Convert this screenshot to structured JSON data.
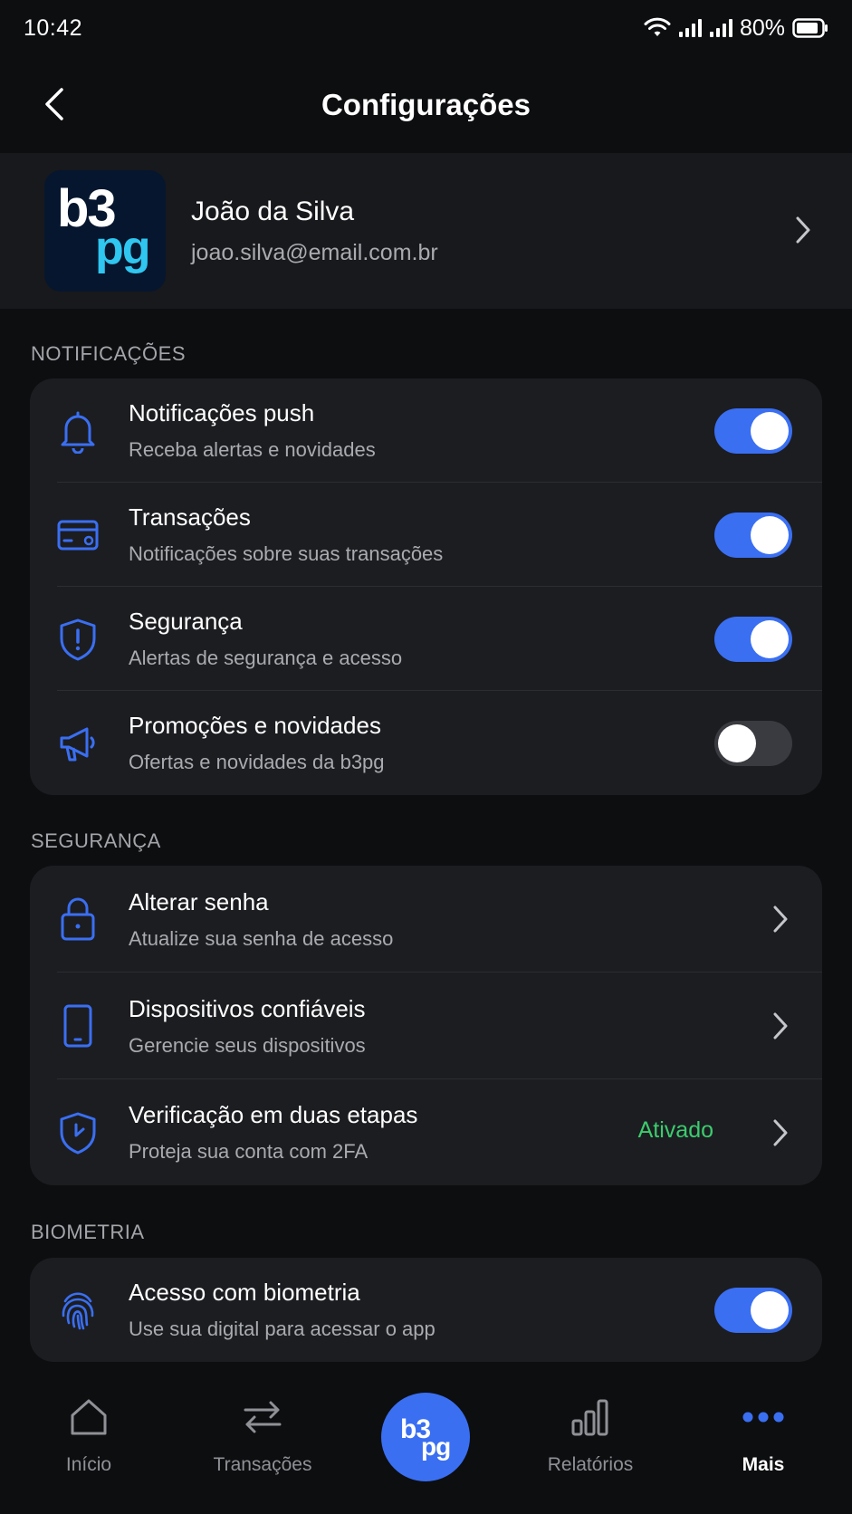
{
  "status_bar": {
    "time": "10:42",
    "battery": "80%"
  },
  "header": {
    "title": "Configurações"
  },
  "profile": {
    "name": "João da Silva",
    "email": "joao.silva@email.com.br",
    "logo_top": "b3",
    "logo_bottom": "pg"
  },
  "sections": {
    "notifications": {
      "label": "NOTIFICAÇÕES",
      "items": [
        {
          "title": "Notificações push",
          "subtitle": "Receba alertas e novidades",
          "icon": "bell-icon",
          "enabled": true
        },
        {
          "title": "Transações",
          "subtitle": "Notificações sobre suas transações",
          "icon": "card-icon",
          "enabled": true
        },
        {
          "title": "Segurança",
          "subtitle": "Alertas de segurança e acesso",
          "icon": "shield-alert-icon",
          "enabled": true
        },
        {
          "title": "Promoções e novidades",
          "subtitle": "Ofertas e novidades da b3pg",
          "icon": "megaphone-icon",
          "enabled": false
        }
      ]
    },
    "security": {
      "label": "SEGURANÇA",
      "items": [
        {
          "title": "Alterar senha",
          "subtitle": "Atualize sua senha de acesso",
          "icon": "lock-icon"
        },
        {
          "title": "Dispositivos confiáveis",
          "subtitle": "Gerencie seus dispositivos",
          "icon": "phone-icon"
        },
        {
          "title": "Verificação em duas etapas",
          "subtitle": "Proteja sua conta com 2FA",
          "icon": "shield-check-icon",
          "status": "Ativado"
        }
      ]
    },
    "biometrics": {
      "label": "BIOMETRIA",
      "items": [
        {
          "title": "Acesso com biometria",
          "subtitle": "Use sua digital para acessar o app",
          "icon": "fingerprint-icon",
          "enabled": true
        }
      ]
    }
  },
  "bottom_nav": {
    "items": [
      {
        "label": "Início",
        "icon": "home-icon",
        "active": false
      },
      {
        "label": "Transações",
        "icon": "transfer-icon",
        "active": false
      },
      {
        "label": "Relatórios",
        "icon": "bar-chart-icon",
        "active": false
      },
      {
        "label": "Mais",
        "icon": "more-dots-icon",
        "active": true
      }
    ],
    "center_logo_top": "b3",
    "center_logo_bottom": "pg"
  },
  "colors": {
    "accent": "#3a6ff2",
    "success": "#3ccc6e",
    "background": "#0d0e10",
    "card": "#1c1d21"
  }
}
